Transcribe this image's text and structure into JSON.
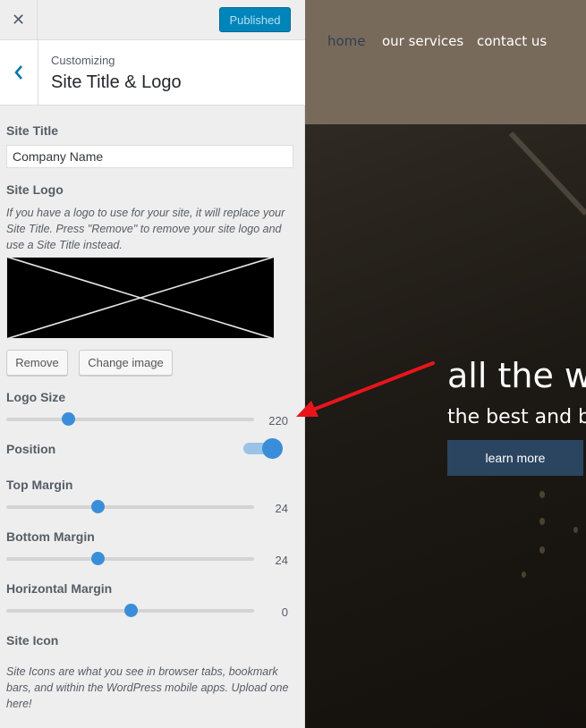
{
  "topbar": {
    "close_icon": "close-icon",
    "publish_label": "Published",
    "publish_color": "#0085ba"
  },
  "section": {
    "back_icon": "chevron-left-icon",
    "customizing_label": "Customizing",
    "title": "Site Title & Logo"
  },
  "site_title": {
    "label": "Site Title",
    "value": "Company Name"
  },
  "site_logo": {
    "label": "Site Logo",
    "description": "If you have a logo to use for your site, it will replace your Site Title. Press \"Remove\" to remove your site logo and use a Site Title instead.",
    "remove_label": "Remove",
    "change_label": "Change image"
  },
  "logo_size": {
    "label": "Logo Size",
    "value": "220",
    "fraction": 0.25
  },
  "position": {
    "label": "Position",
    "toggle_on": true
  },
  "top_margin": {
    "label": "Top Margin",
    "value": "24",
    "fraction": 0.37
  },
  "bottom_margin": {
    "label": "Bottom Margin",
    "value": "24",
    "fraction": 0.37
  },
  "horizontal_margin": {
    "label": "Horizontal Margin",
    "value": "0",
    "fraction": 0.5
  },
  "site_icon": {
    "label": "Site Icon",
    "description": "Site Icons are what you see in browser tabs, bookmark bars, and within the WordPress mobile apps. Upload one here!"
  },
  "preview": {
    "nav": [
      "home",
      "our services",
      "contact us"
    ],
    "hero_title": "all the w",
    "hero_subtitle": "the best and b",
    "cta_label": "learn more",
    "accent_color": "#2b4560"
  },
  "annotation": {
    "arrow_color": "#e8151b"
  }
}
